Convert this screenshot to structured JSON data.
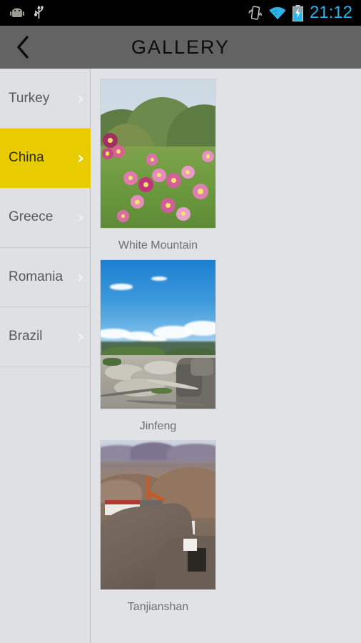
{
  "statusbar": {
    "time": "21:12",
    "icons": [
      "android-robot-icon",
      "usb-icon",
      "vibrate-icon",
      "wifi-icon",
      "battery-charging-icon"
    ],
    "time_color": "#21b4e8"
  },
  "actionbar": {
    "title": "GALLERY",
    "back_icon": "chevron-left-icon",
    "background_color": "#636363"
  },
  "sidebar": {
    "selected_index": 1,
    "accent_color": "#e8cc00",
    "items": [
      {
        "label": "Turkey",
        "chevron": "chevron-right-icon",
        "selected": false
      },
      {
        "label": "China",
        "chevron": "chevron-right-icon",
        "selected": true
      },
      {
        "label": "Greece",
        "chevron": "chevron-right-icon",
        "selected": false
      },
      {
        "label": "Romania",
        "chevron": "chevron-right-icon",
        "selected": false
      },
      {
        "label": "Brazil",
        "chevron": "chevron-right-icon",
        "selected": false
      }
    ]
  },
  "gallery": {
    "items": [
      {
        "caption": "White Mountain",
        "art": "wm"
      },
      {
        "caption": "Jinfeng",
        "art": "jf"
      },
      {
        "caption": "Tanjianshan",
        "art": "tj"
      }
    ]
  }
}
